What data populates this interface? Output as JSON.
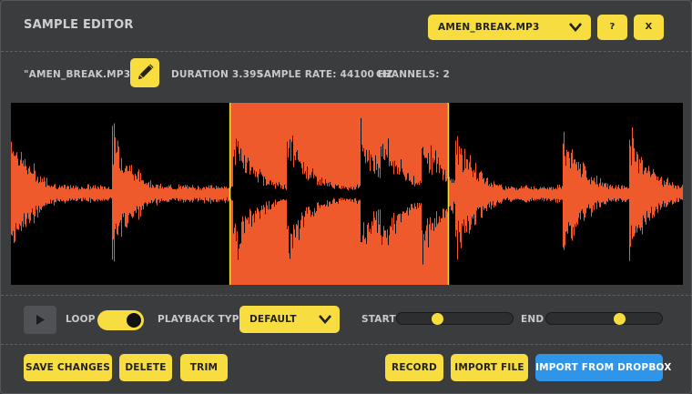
{
  "header": {
    "title": "SAMPLE EDITOR",
    "file_select": {
      "value": "AMEN_BREAK.MP3"
    },
    "help_label": "?",
    "close_label": "X"
  },
  "info": {
    "filename": "\"AMEN_BREAK.MP3\"",
    "duration": "DURATION 3.395",
    "sample_rate": "SAMPLE RATE: 44100 HZ",
    "channels": "CHANNELS: 2"
  },
  "waveform": {
    "selection_start_fraction": 0.326,
    "selection_end_fraction": 0.651,
    "colors": {
      "wave": "#ee5a2b",
      "selection": "#ee5a2b",
      "selected_wave": "#000000",
      "background": "#000000",
      "marker": "#f7dd3f"
    }
  },
  "controls": {
    "play_icon": "play-icon",
    "loop_label": "LOOP",
    "loop_on": true,
    "playback_type_label": "PLAYBACK TYPE",
    "playback_type": {
      "value": "DEFAULT"
    },
    "start_label": "START",
    "start_value": 0.35,
    "end_label": "END",
    "end_value": 0.63
  },
  "footer": {
    "save_label": "SAVE CHANGES",
    "delete_label": "DELETE",
    "trim_label": "TRIM",
    "record_label": "RECORD",
    "import_file_label": "IMPORT FILE",
    "import_dropbox_label": "IMPORT FROM DROPBOX"
  },
  "colors": {
    "accent": "#f7dd3f",
    "panel": "#3b3c3e",
    "blue": "#2f95e8"
  }
}
